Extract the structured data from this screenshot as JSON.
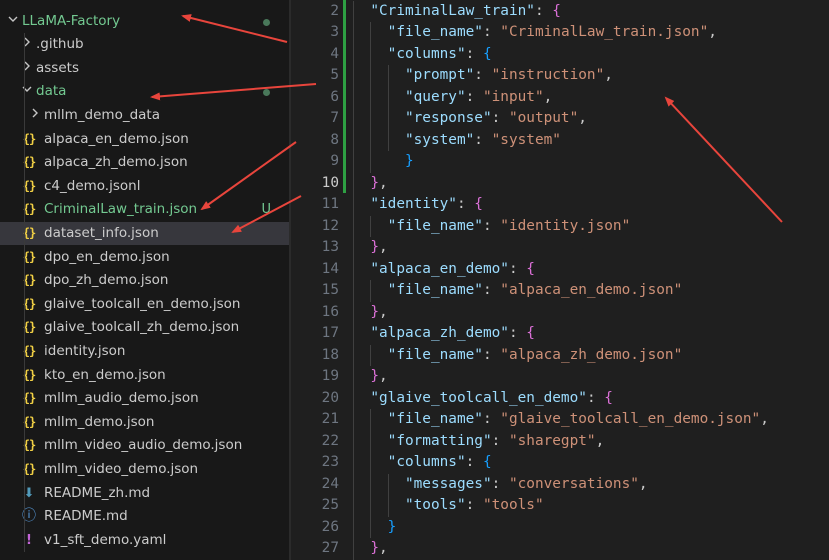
{
  "explorer": {
    "items": [
      {
        "label": "LLaMA-Factory",
        "type": "folder-open",
        "depth": 0,
        "status": "dot",
        "green": true
      },
      {
        "label": ".github",
        "type": "folder",
        "depth": 1
      },
      {
        "label": "assets",
        "type": "folder",
        "depth": 1
      },
      {
        "label": "data",
        "type": "folder-open",
        "depth": 1,
        "status": "dot",
        "green": true
      },
      {
        "label": "mllm_demo_data",
        "type": "folder",
        "depth": 2
      },
      {
        "label": "alpaca_en_demo.json",
        "type": "json",
        "depth": 2
      },
      {
        "label": "alpaca_zh_demo.json",
        "type": "json",
        "depth": 2
      },
      {
        "label": "c4_demo.jsonl",
        "type": "json",
        "depth": 2
      },
      {
        "label": "CriminalLaw_train.json",
        "type": "json",
        "depth": 2,
        "status": "U",
        "green": true
      },
      {
        "label": "dataset_info.json",
        "type": "json",
        "depth": 2,
        "selected": true
      },
      {
        "label": "dpo_en_demo.json",
        "type": "json",
        "depth": 2
      },
      {
        "label": "dpo_zh_demo.json",
        "type": "json",
        "depth": 2
      },
      {
        "label": "glaive_toolcall_en_demo.json",
        "type": "json",
        "depth": 2
      },
      {
        "label": "glaive_toolcall_zh_demo.json",
        "type": "json",
        "depth": 2
      },
      {
        "label": "identity.json",
        "type": "json",
        "depth": 2
      },
      {
        "label": "kto_en_demo.json",
        "type": "json",
        "depth": 2
      },
      {
        "label": "mllm_audio_demo.json",
        "type": "json",
        "depth": 2
      },
      {
        "label": "mllm_demo.json",
        "type": "json",
        "depth": 2
      },
      {
        "label": "mllm_video_audio_demo.json",
        "type": "json",
        "depth": 2
      },
      {
        "label": "mllm_video_demo.json",
        "type": "json",
        "depth": 2
      },
      {
        "label": "README_zh.md",
        "type": "md",
        "depth": 2
      },
      {
        "label": "README.md",
        "type": "info",
        "depth": 2
      },
      {
        "label": "v1_sft_demo.yaml",
        "type": "yaml",
        "depth": 2
      }
    ]
  },
  "icons": {
    "folder-open": "chevron-down-icon",
    "folder": "chevron-right-icon",
    "json": "json-braces-icon",
    "md": "markdown-arrow-icon",
    "info": "info-icon",
    "yaml": "yaml-exclamation-icon"
  },
  "editor": {
    "active_line": 10,
    "lines": [
      {
        "n": "2",
        "t": [
          [
            "  ",
            "p"
          ],
          [
            "\"CriminalLaw_train\"",
            "k"
          ],
          [
            ": ",
            "p"
          ],
          [
            "{",
            "b2"
          ]
        ]
      },
      {
        "n": "3",
        "t": [
          [
            "    ",
            "p"
          ],
          [
            "\"file_name\"",
            "k"
          ],
          [
            ": ",
            "p"
          ],
          [
            "\"CriminalLaw_train.json\"",
            "s"
          ],
          [
            ",",
            "p"
          ]
        ]
      },
      {
        "n": "4",
        "t": [
          [
            "    ",
            "p"
          ],
          [
            "\"columns\"",
            "k"
          ],
          [
            ": ",
            "p"
          ],
          [
            "{",
            "b3"
          ]
        ]
      },
      {
        "n": "5",
        "t": [
          [
            "      ",
            "p"
          ],
          [
            "\"prompt\"",
            "k"
          ],
          [
            ": ",
            "p"
          ],
          [
            "\"instruction\"",
            "s"
          ],
          [
            ",",
            "p"
          ]
        ]
      },
      {
        "n": "6",
        "t": [
          [
            "      ",
            "p"
          ],
          [
            "\"query\"",
            "k"
          ],
          [
            ": ",
            "p"
          ],
          [
            "\"input\"",
            "s"
          ],
          [
            ",",
            "p"
          ]
        ]
      },
      {
        "n": "7",
        "t": [
          [
            "      ",
            "p"
          ],
          [
            "\"response\"",
            "k"
          ],
          [
            ": ",
            "p"
          ],
          [
            "\"output\"",
            "s"
          ],
          [
            ",",
            "p"
          ]
        ]
      },
      {
        "n": "8",
        "t": [
          [
            "      ",
            "p"
          ],
          [
            "\"system\"",
            "k"
          ],
          [
            ": ",
            "p"
          ],
          [
            "\"system\"",
            "s"
          ]
        ]
      },
      {
        "n": "9",
        "t": [
          [
            "      ",
            "p"
          ],
          [
            "}",
            "b3"
          ]
        ]
      },
      {
        "n": "10",
        "t": [
          [
            "  ",
            "p"
          ],
          [
            "}",
            "b2"
          ],
          [
            ",",
            "p"
          ]
        ]
      },
      {
        "n": "11",
        "t": [
          [
            "  ",
            "p"
          ],
          [
            "\"identity\"",
            "k"
          ],
          [
            ": ",
            "p"
          ],
          [
            "{",
            "b2"
          ]
        ]
      },
      {
        "n": "12",
        "t": [
          [
            "    ",
            "p"
          ],
          [
            "\"file_name\"",
            "k"
          ],
          [
            ": ",
            "p"
          ],
          [
            "\"identity.json\"",
            "s"
          ]
        ]
      },
      {
        "n": "13",
        "t": [
          [
            "  ",
            "p"
          ],
          [
            "}",
            "b2"
          ],
          [
            ",",
            "p"
          ]
        ]
      },
      {
        "n": "14",
        "t": [
          [
            "  ",
            "p"
          ],
          [
            "\"alpaca_en_demo\"",
            "k"
          ],
          [
            ": ",
            "p"
          ],
          [
            "{",
            "b2"
          ]
        ]
      },
      {
        "n": "15",
        "t": [
          [
            "    ",
            "p"
          ],
          [
            "\"file_name\"",
            "k"
          ],
          [
            ": ",
            "p"
          ],
          [
            "\"alpaca_en_demo.json\"",
            "s"
          ]
        ]
      },
      {
        "n": "16",
        "t": [
          [
            "  ",
            "p"
          ],
          [
            "}",
            "b2"
          ],
          [
            ",",
            "p"
          ]
        ]
      },
      {
        "n": "17",
        "t": [
          [
            "  ",
            "p"
          ],
          [
            "\"alpaca_zh_demo\"",
            "k"
          ],
          [
            ": ",
            "p"
          ],
          [
            "{",
            "b2"
          ]
        ]
      },
      {
        "n": "18",
        "t": [
          [
            "    ",
            "p"
          ],
          [
            "\"file_name\"",
            "k"
          ],
          [
            ": ",
            "p"
          ],
          [
            "\"alpaca_zh_demo.json\"",
            "s"
          ]
        ]
      },
      {
        "n": "19",
        "t": [
          [
            "  ",
            "p"
          ],
          [
            "}",
            "b2"
          ],
          [
            ",",
            "p"
          ]
        ]
      },
      {
        "n": "20",
        "t": [
          [
            "  ",
            "p"
          ],
          [
            "\"glaive_toolcall_en_demo\"",
            "k"
          ],
          [
            ": ",
            "p"
          ],
          [
            "{",
            "b2"
          ]
        ]
      },
      {
        "n": "21",
        "t": [
          [
            "    ",
            "p"
          ],
          [
            "\"file_name\"",
            "k"
          ],
          [
            ": ",
            "p"
          ],
          [
            "\"glaive_toolcall_en_demo.json\"",
            "s"
          ],
          [
            ",",
            "p"
          ]
        ]
      },
      {
        "n": "22",
        "t": [
          [
            "    ",
            "p"
          ],
          [
            "\"formatting\"",
            "k"
          ],
          [
            ": ",
            "p"
          ],
          [
            "\"sharegpt\"",
            "s"
          ],
          [
            ",",
            "p"
          ]
        ]
      },
      {
        "n": "23",
        "t": [
          [
            "    ",
            "p"
          ],
          [
            "\"columns\"",
            "k"
          ],
          [
            ": ",
            "p"
          ],
          [
            "{",
            "b3"
          ]
        ]
      },
      {
        "n": "24",
        "t": [
          [
            "      ",
            "p"
          ],
          [
            "\"messages\"",
            "k"
          ],
          [
            ": ",
            "p"
          ],
          [
            "\"conversations\"",
            "s"
          ],
          [
            ",",
            "p"
          ]
        ]
      },
      {
        "n": "25",
        "t": [
          [
            "      ",
            "p"
          ],
          [
            "\"tools\"",
            "k"
          ],
          [
            ": ",
            "p"
          ],
          [
            "\"tools\"",
            "s"
          ]
        ]
      },
      {
        "n": "26",
        "t": [
          [
            "    ",
            "p"
          ],
          [
            "}",
            "b3"
          ]
        ]
      },
      {
        "n": "27",
        "t": [
          [
            "  ",
            "p"
          ],
          [
            "}",
            "b2"
          ],
          [
            ",",
            "p"
          ]
        ]
      }
    ]
  },
  "colors": {
    "annotation_arrow": "#e8453c",
    "git_untracked": "#73c991",
    "selection": "#37373d"
  }
}
